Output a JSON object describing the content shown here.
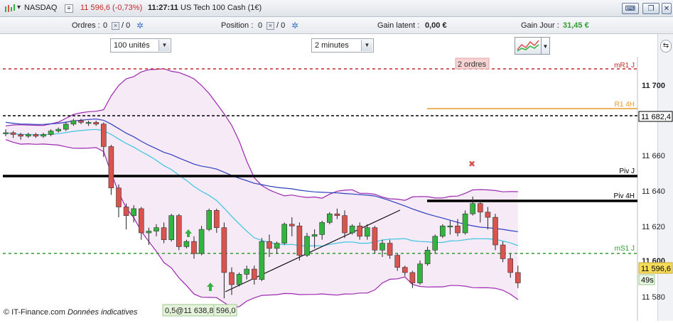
{
  "titlebar": {
    "instrument": "NASDAQ",
    "price_change": "11 596,6 (-0,73%)",
    "time": "11:27:11",
    "product": "US Tech 100 Cash (1€)"
  },
  "toolbar": {
    "orders_label": "Ordres :",
    "orders_value": "0",
    "orders_slash": "/ 0",
    "position_label": "Position :",
    "position_value": "0",
    "position_slash": "/ 0",
    "gain_latent_label": "Gain latent :",
    "gain_latent_value": "0,00 €",
    "gain_jour_label": "Gain Jour :",
    "gain_jour_value": "31,45 €"
  },
  "controls": {
    "units_select": "100 unités",
    "timeframe_select": "2 minutes"
  },
  "chart": {
    "orders_badge": "2 ordres",
    "levels": {
      "mR1J": "mR1 J",
      "R14H": "R1 4H",
      "PivJ": "Piv J",
      "Piv4H": "Piv 4H",
      "mS1J": "mS1 J"
    },
    "axis_ticks": [
      "11 700",
      "11 680",
      "11 660",
      "11 640",
      "11 620",
      "11 600",
      "11 580"
    ],
    "price_marker": "11 682,4",
    "current_price": "11 596,6",
    "countdown": "49s",
    "footer_copyright": "© IT-Finance.com",
    "footer_note": "Données indicatives",
    "order_label": "0,5@11 638,8",
    "order_label2": "596,0"
  },
  "chart_data": {
    "type": "candlestick",
    "candles": [
      [
        11684,
        11686,
        11682,
        11684
      ],
      [
        11684,
        11685,
        11681,
        11683
      ],
      [
        11683,
        11684,
        11680,
        11682
      ],
      [
        11682,
        11684,
        11681,
        11683
      ],
      [
        11683,
        11684,
        11681,
        11682
      ],
      [
        11682,
        11684,
        11681,
        11683
      ],
      [
        11683,
        11686,
        11682,
        11685
      ],
      [
        11685,
        11687,
        11684,
        11686
      ],
      [
        11686,
        11690,
        11685,
        11689
      ],
      [
        11689,
        11692,
        11688,
        11691
      ],
      [
        11691,
        11692,
        11689,
        11690
      ],
      [
        11690,
        11691,
        11688,
        11690
      ],
      [
        11690,
        11691,
        11688,
        11689
      ],
      [
        11689,
        11690,
        11670,
        11676
      ],
      [
        11676,
        11677,
        11648,
        11652
      ],
      [
        11652,
        11654,
        11635,
        11641
      ],
      [
        11641,
        11643,
        11628,
        11636
      ],
      [
        11636,
        11642,
        11632,
        11640
      ],
      [
        11640,
        11641,
        11622,
        11626
      ],
      [
        11626,
        11629,
        11619,
        11627
      ],
      [
        11627,
        11631,
        11624,
        11629
      ],
      [
        11629,
        11632,
        11620,
        11622
      ],
      [
        11622,
        11637,
        11621,
        11636
      ],
      [
        11636,
        11637,
        11616,
        11618
      ],
      [
        11618,
        11622,
        11617,
        11621
      ],
      [
        11621,
        11624,
        11611,
        11614
      ],
      [
        11614,
        11630,
        11613,
        11628
      ],
      [
        11628,
        11640,
        11627,
        11639
      ],
      [
        11639,
        11640,
        11626,
        11629
      ],
      [
        11629,
        11632,
        11588,
        11603
      ],
      [
        11603,
        11606,
        11590,
        11596
      ],
      [
        11596,
        11603,
        11595,
        11602
      ],
      [
        11602,
        11607,
        11599,
        11605
      ],
      [
        11605,
        11607,
        11596,
        11599
      ],
      [
        11599,
        11623,
        11598,
        11621
      ],
      [
        11621,
        11625,
        11612,
        11617
      ],
      [
        11617,
        11621,
        11614,
        11620
      ],
      [
        11620,
        11632,
        11619,
        11631
      ],
      [
        11631,
        11635,
        11624,
        11630
      ],
      [
        11630,
        11632,
        11610,
        11613
      ],
      [
        11613,
        11626,
        11612,
        11624
      ],
      [
        11624,
        11628,
        11617,
        11625
      ],
      [
        11625,
        11633,
        11622,
        11632
      ],
      [
        11632,
        11638,
        11631,
        11637
      ],
      [
        11637,
        11640,
        11634,
        11636
      ],
      [
        11636,
        11639,
        11623,
        11626
      ],
      [
        11626,
        11631,
        11625,
        11630
      ],
      [
        11630,
        11632,
        11622,
        11624
      ],
      [
        11624,
        11631,
        11622,
        11629
      ],
      [
        11629,
        11630,
        11614,
        11616
      ],
      [
        11616,
        11622,
        11612,
        11620
      ],
      [
        11620,
        11622,
        11611,
        11613
      ],
      [
        11613,
        11614,
        11604,
        11606
      ],
      [
        11606,
        11607,
        11601,
        11603
      ],
      [
        11603,
        11604,
        11594,
        11597
      ],
      [
        11597,
        11610,
        11596,
        11608
      ],
      [
        11608,
        11618,
        11607,
        11616
      ],
      [
        11616,
        11625,
        11614,
        11624
      ],
      [
        11624,
        11631,
        11623,
        11630
      ],
      [
        11630,
        11633,
        11625,
        11630
      ],
      [
        11630,
        11634,
        11624,
        11626
      ],
      [
        11626,
        11639,
        11625,
        11637
      ],
      [
        11637,
        11647,
        11636,
        11643
      ],
      [
        11643,
        11645,
        11632,
        11638
      ],
      [
        11638,
        11641,
        11628,
        11635
      ],
      [
        11635,
        11637,
        11616,
        11619
      ],
      [
        11619,
        11621,
        11609,
        11611
      ],
      [
        11611,
        11614,
        11600,
        11603
      ],
      [
        11603,
        11607,
        11594,
        11597
      ]
    ],
    "yrange": [
      11575,
      11728
    ]
  },
  "colors": {
    "up": "#33b440",
    "down": "#d9534f",
    "band": "#9c27b0",
    "ma_blue": "#2e3fbf",
    "ma_cyan": "#3ec5e0",
    "gain_positive": "#2e9e2e"
  }
}
